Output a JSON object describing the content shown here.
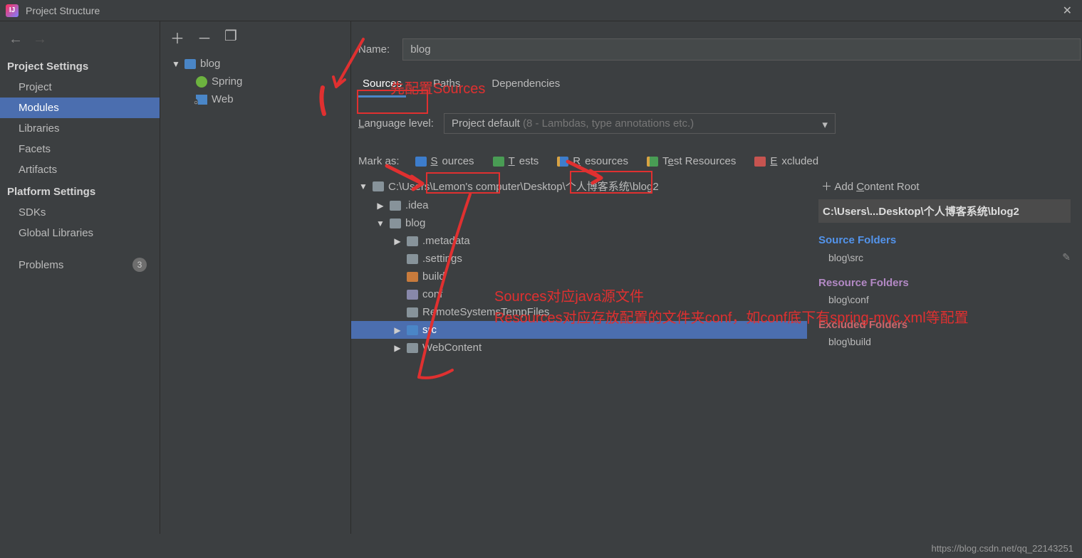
{
  "window": {
    "title": "Project Structure"
  },
  "nav": {
    "sections": {
      "project_settings": "Project Settings",
      "platform_settings": "Platform Settings"
    },
    "items": {
      "project": "Project",
      "modules": "Modules",
      "libraries": "Libraries",
      "facets": "Facets",
      "artifacts": "Artifacts",
      "sdks": "SDKs",
      "global_libraries": "Global Libraries",
      "problems": "Problems"
    },
    "problems_count": "3"
  },
  "midtree": {
    "root": "blog",
    "children": {
      "spring": "Spring",
      "web": "Web"
    }
  },
  "form": {
    "name_label": "Name:",
    "name_value": "blog",
    "tabs": {
      "sources": "Sources",
      "paths": "Paths",
      "dependencies": "Dependencies"
    },
    "lang_label": "Language level:",
    "lang_value": "Project default ",
    "lang_hint": "(8 - Lambdas, type annotations etc.)",
    "mark_label": "Mark as:",
    "mark": {
      "sources": "Sources",
      "tests": "Tests",
      "resources": "Resources",
      "test_resources": "Test Resources",
      "excluded": "Excluded"
    }
  },
  "dirtree": {
    "root": "C:\\Users\\Lemon's computer\\Desktop\\个人博客系统\\blog2",
    "items": {
      "idea": ".idea",
      "blog": "blog",
      "metadata": ".metadata",
      "settings": ".settings",
      "build": "build",
      "conf": "conf",
      "rst": "RemoteSystemsTempFiles",
      "src": "src",
      "webcontent": "WebContent"
    }
  },
  "content_root": {
    "add": "Add Content Root",
    "path": "C:\\Users\\...Desktop\\个人博客系统\\blog2",
    "source_hdr": "Source Folders",
    "source_item": "blog\\src",
    "resource_hdr": "Resource Folders",
    "resource_item": "blog\\conf",
    "excluded_hdr": "Excluded Folders",
    "excluded_item": "blog\\build"
  },
  "annotations": {
    "a1": "先配置Sources",
    "a2": "Sources对应java源文件",
    "a3": "Resources对应存放配置的文件夹conf，如conf底下有spring-mvc.xml等配置"
  },
  "footer": {
    "url": "https://blog.csdn.net/qq_22143251"
  }
}
